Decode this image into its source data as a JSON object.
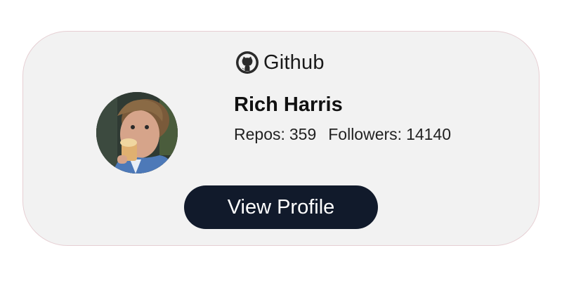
{
  "card": {
    "brand": {
      "icon": "github-icon",
      "label": "Github"
    },
    "avatar": {
      "icon": "user-avatar-photo"
    },
    "user": {
      "name": "Rich Harris"
    },
    "stats": {
      "repos_label": "Repos:",
      "repos_value": "359",
      "followers_label": "Followers:",
      "followers_value": "14140"
    },
    "view_profile_label": "View Profile"
  },
  "colors": {
    "card_background": "#f2f2f2",
    "button_background": "#111a2b",
    "button_text": "#ffffff",
    "text_primary": "#111111"
  }
}
